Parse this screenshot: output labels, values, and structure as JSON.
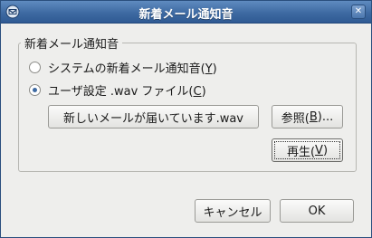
{
  "window": {
    "title": "新着メール通知音"
  },
  "group": {
    "legend": "新着メール通知音"
  },
  "options": {
    "system_sound": {
      "label_pre": "システムの新着メール通知音(",
      "mnemonic": "Y",
      "label_post": ")",
      "checked": false
    },
    "user_wav": {
      "label_pre": "ユーザ設定 .wav ファイル(",
      "mnemonic": "C",
      "label_post": ")",
      "checked": true
    }
  },
  "file_button": {
    "label": "新しいメールが届いています.wav"
  },
  "browse_button": {
    "label_pre": "参照(",
    "mnemonic": "B",
    "label_post": ")..."
  },
  "play_button": {
    "label_pre": "再生(",
    "mnemonic": "V",
    "label_post": ")"
  },
  "footer": {
    "cancel_label": "キャンセル",
    "ok_label": "OK"
  },
  "colors": {
    "titlebar": "#3e6aa2",
    "background": "#eeeeec"
  }
}
